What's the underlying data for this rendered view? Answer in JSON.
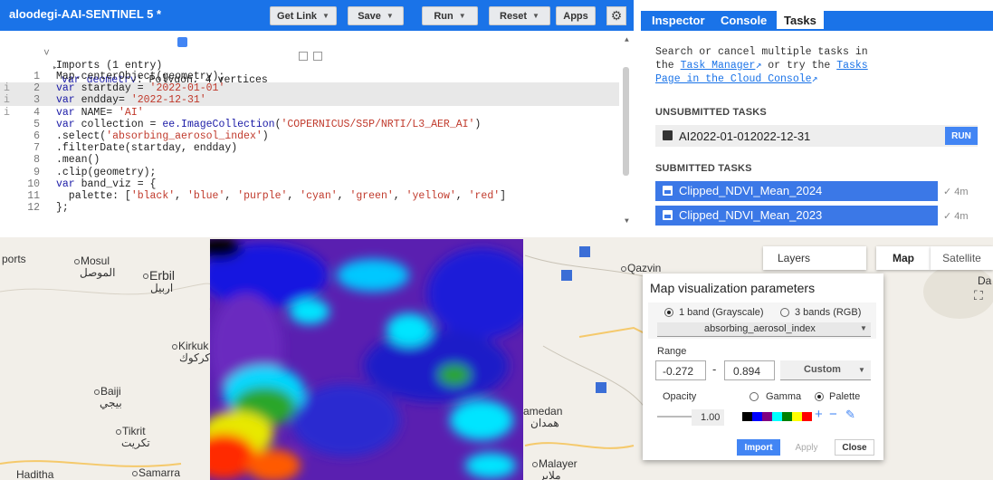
{
  "editor": {
    "title": "aloodegi-AAI-SENTINEL 5 *",
    "buttons": {
      "get_link": "Get Link",
      "save": "Save",
      "run": "Run",
      "reset": "Reset",
      "apps": "Apps"
    },
    "imports_header": "Imports (1 entry)",
    "import_line_kw": "var",
    "import_line_name": "geometry",
    "import_line_desc": ": Polygon, 4 vertices",
    "code": [
      {
        "n": "1",
        "t": "Map.centerObject(geometry);"
      },
      {
        "n": "2",
        "t": "var startday = '2022-01-01'"
      },
      {
        "n": "3",
        "t": "var endday= '2022-12-31'"
      },
      {
        "n": "4",
        "t": "var NAME= 'AI'"
      },
      {
        "n": "5",
        "t": "var collection = ee.ImageCollection('COPERNICUS/S5P/NRTI/L3_AER_AI')"
      },
      {
        "n": "6",
        "t": ".select('absorbing_aerosol_index')"
      },
      {
        "n": "7",
        "t": ".filterDate(startday, endday)"
      },
      {
        "n": "8",
        "t": ".mean()"
      },
      {
        "n": "9",
        "t": ".clip(geometry);"
      },
      {
        "n": "10",
        "t": "var band_viz = {"
      },
      {
        "n": "11",
        "t": "  palette: ['black', 'blue', 'purple', 'cyan', 'green', 'yellow', 'red']"
      },
      {
        "n": "12",
        "t": "};"
      }
    ]
  },
  "panel": {
    "tabs": [
      "Inspector",
      "Console",
      "Tasks"
    ],
    "active_tab": "Tasks",
    "intro_1": "Search or cancel multiple tasks in",
    "intro_2a": "the ",
    "task_manager": "Task Manager",
    "intro_2b": " or try the ",
    "tasks_link_1": "Tasks",
    "tasks_link_2": "Page in the Cloud Console",
    "unsubmitted_heading": "UNSUBMITTED TASKS",
    "unsubmitted_task": "AI2022-01-012022-12-31",
    "run_label": "RUN",
    "submitted_heading": "SUBMITTED TASKS",
    "submitted": [
      {
        "name": "Clipped_NDVI_Mean_2024",
        "time": "4m"
      },
      {
        "name": "Clipped_NDVI_Mean_2023",
        "time": "4m"
      }
    ]
  },
  "map": {
    "layers_label": "Layers",
    "map_label": "Map",
    "satellite_label": "Satellite",
    "cities": {
      "ports": "ports",
      "mosul": "Mosul",
      "mosul_ar": "الموصل",
      "erbil": "Erbil",
      "erbil_ar": "اربيل",
      "kirkuk": "Kirkuk",
      "kirkuk_ar": "كركوك",
      "baiji": "Baiji",
      "baiji_ar": "بيجي",
      "tikrit": "Tikrit",
      "tikrit_ar": "تكريت",
      "samarra": "Samarra",
      "haditha": "Haditha",
      "qazvin": "Qazvin",
      "hamedan": "amedan",
      "hamedan_ar": "همدان",
      "malayer": "Malayer",
      "malayer_ar": "ملاير",
      "da": "Da"
    }
  },
  "vis": {
    "title": "Map visualization parameters",
    "mode_1": "1 band (Grayscale)",
    "mode_3": "3 bands (RGB)",
    "band": "absorbing_aerosol_index",
    "range_label": "Range",
    "range_min": "-0.272",
    "range_max": "0.894",
    "range_mode": "Custom",
    "opacity_label": "Opacity",
    "opacity_value": "1.00",
    "gamma_label": "Gamma",
    "palette_label": "Palette",
    "palette_colors": [
      "#000000",
      "#0000ff",
      "#800080",
      "#00ffff",
      "#008000",
      "#ffff00",
      "#ff0000"
    ],
    "import_label": "Import",
    "apply_label": "Apply",
    "close_label": "Close"
  }
}
